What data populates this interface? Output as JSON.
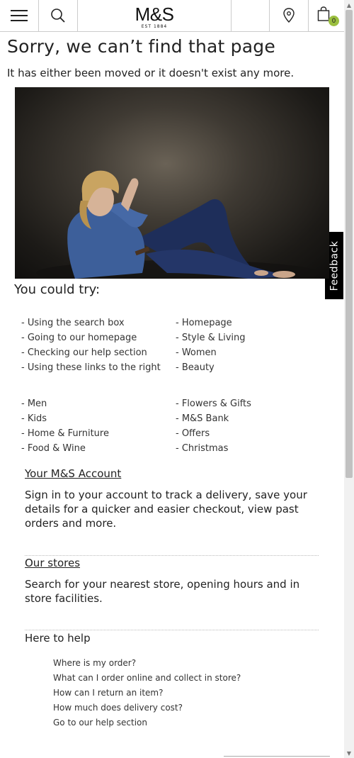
{
  "header": {
    "brand": "M&S",
    "brand_sub": "EST 1884",
    "bag_count": "0",
    "icons": [
      "hamburger-icon",
      "search-icon",
      "store-locator-icon",
      "bag-icon"
    ],
    "badge_color": "#9bbf3f"
  },
  "page": {
    "title": "Sorry, we can’t find that page",
    "subtitle": "It has either been moved or it doesn't exist any more."
  },
  "feedback": "Feedback",
  "try": {
    "title": "You could try:",
    "left_top": [
      "- Using the search box",
      "- Going to our homepage",
      "- Checking our help section",
      "- Using these links to the right"
    ],
    "right_top": [
      "- Homepage",
      "- Style & Living",
      "- Women",
      "- Beauty"
    ],
    "left_bottom": [
      "- Men",
      "- Kids",
      "- Home & Furniture",
      "- Food & Wine"
    ],
    "right_bottom": [
      "- Flowers & Gifts",
      "- M&S Bank",
      "- Offers",
      "- Christmas"
    ]
  },
  "account": {
    "link": "Your M&S Account",
    "text": "Sign in to your account to track a delivery, save your details for a quicker and easier checkout, view past orders and more."
  },
  "stores": {
    "link": "Our stores",
    "text": "Search for your nearest store, opening hours and in store facilities."
  },
  "help": {
    "title": "Here to help",
    "links": [
      "Where is my order?",
      "What can I order online and collect in store?",
      "How can I return an item?",
      "How much does delivery cost?",
      "Go to our help section"
    ]
  }
}
